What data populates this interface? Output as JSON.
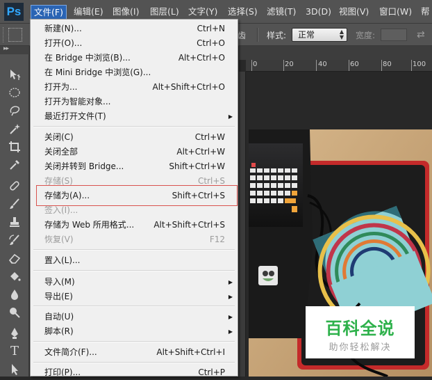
{
  "app": {
    "logo": "Ps",
    "colors": {
      "ui_gray": "#535353",
      "menu_bg": "#f0f0f0",
      "active_menu": "#2a64b4",
      "highlight_border": "#d9534f",
      "watermark_green": "#2eb14b"
    }
  },
  "menubar": {
    "items": [
      {
        "label": "文件(F)",
        "active": true
      },
      {
        "label": "编辑(E)"
      },
      {
        "label": "图像(I)"
      },
      {
        "label": "图层(L)"
      },
      {
        "label": "文字(Y)"
      },
      {
        "label": "选择(S)"
      },
      {
        "label": "滤镜(T)"
      },
      {
        "label": "3D(D)"
      },
      {
        "label": "视图(V)"
      },
      {
        "label": "窗口(W)"
      },
      {
        "label": "帮"
      }
    ]
  },
  "options_bar": {
    "partial_label": "齿",
    "style_label": "样式:",
    "style_value": "正常",
    "width_label": "宽度:",
    "swap_icon": "swap-arrows-icon"
  },
  "ruler": {
    "ticks": [
      "0",
      "20",
      "40",
      "60",
      "80",
      "100"
    ]
  },
  "file_menu": {
    "items": [
      {
        "label": "新建(N)...",
        "shortcut": "Ctrl+N"
      },
      {
        "label": "打开(O)...",
        "shortcut": "Ctrl+O"
      },
      {
        "label": "在 Bridge 中浏览(B)...",
        "shortcut": "Alt+Ctrl+O"
      },
      {
        "label": "在 Mini Bridge 中浏览(G)...",
        "shortcut": ""
      },
      {
        "label": "打开为...",
        "shortcut": "Alt+Shift+Ctrl+O"
      },
      {
        "label": "打开为智能对象...",
        "shortcut": ""
      },
      {
        "label": "最近打开文件(T)",
        "shortcut": "",
        "submenu": true
      },
      {
        "label": "关闭(C)",
        "shortcut": "Ctrl+W"
      },
      {
        "label": "关闭全部",
        "shortcut": "Alt+Ctrl+W"
      },
      {
        "label": "关闭并转到 Bridge...",
        "shortcut": "Shift+Ctrl+W"
      },
      {
        "label": "存储(S)",
        "shortcut": "Ctrl+S",
        "disabled": true
      },
      {
        "label": "存储为(A)...",
        "shortcut": "Shift+Ctrl+S",
        "highlighted": true
      },
      {
        "label": "签入(I)...",
        "shortcut": "",
        "disabled": true
      },
      {
        "label": "存储为 Web 所用格式...",
        "shortcut": "Alt+Shift+Ctrl+S"
      },
      {
        "label": "恢复(V)",
        "shortcut": "F12",
        "disabled": true
      },
      {
        "label": "置入(L)...",
        "shortcut": ""
      },
      {
        "label": "导入(M)",
        "shortcut": "",
        "submenu": true
      },
      {
        "label": "导出(E)",
        "shortcut": "",
        "submenu": true
      },
      {
        "label": "自动(U)",
        "shortcut": "",
        "submenu": true
      },
      {
        "label": "脚本(R)",
        "shortcut": "",
        "submenu": true
      },
      {
        "label": "文件简介(F)...",
        "shortcut": "Alt+Shift+Ctrl+I"
      },
      {
        "label": "打印(P)...",
        "shortcut": "Ctrl+P"
      }
    ]
  },
  "watermark": {
    "title": "百科全说",
    "subtitle": "助你轻松解决"
  }
}
